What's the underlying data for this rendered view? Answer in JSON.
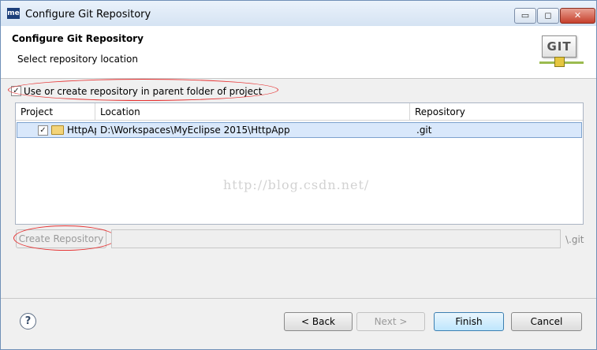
{
  "window": {
    "app_icon": "me",
    "title": "Configure Git Repository",
    "minimize_glyph": "▭",
    "maximize_glyph": "◻",
    "close_glyph": "✕"
  },
  "header": {
    "title": "Configure Git Repository",
    "subtitle": "Select repository location",
    "logo_text": "GIT"
  },
  "options": {
    "use_parent_checked": true,
    "use_parent_label": "Use or create repository in parent folder of project",
    "check_glyph": "✓"
  },
  "table": {
    "columns": [
      "Project",
      "Location",
      "Repository"
    ],
    "rows": [
      {
        "checked": true,
        "project": "HttpApp",
        "location": "D:\\Workspaces\\MyEclipse 2015\\HttpApp",
        "repository": ".git"
      }
    ]
  },
  "watermark": "http://blog.csdn.net/",
  "create_repo": {
    "button_label": "Create Repository",
    "path_value": "",
    "suffix": "\\.git"
  },
  "footer": {
    "help_glyph": "?",
    "back_label": "< Back",
    "next_label": "Next >",
    "finish_label": "Finish",
    "cancel_label": "Cancel"
  },
  "colors": {
    "annotation_red": "#e63232",
    "selection_bg": "#d9e8fb",
    "default_button_border": "#3c7fb1"
  }
}
